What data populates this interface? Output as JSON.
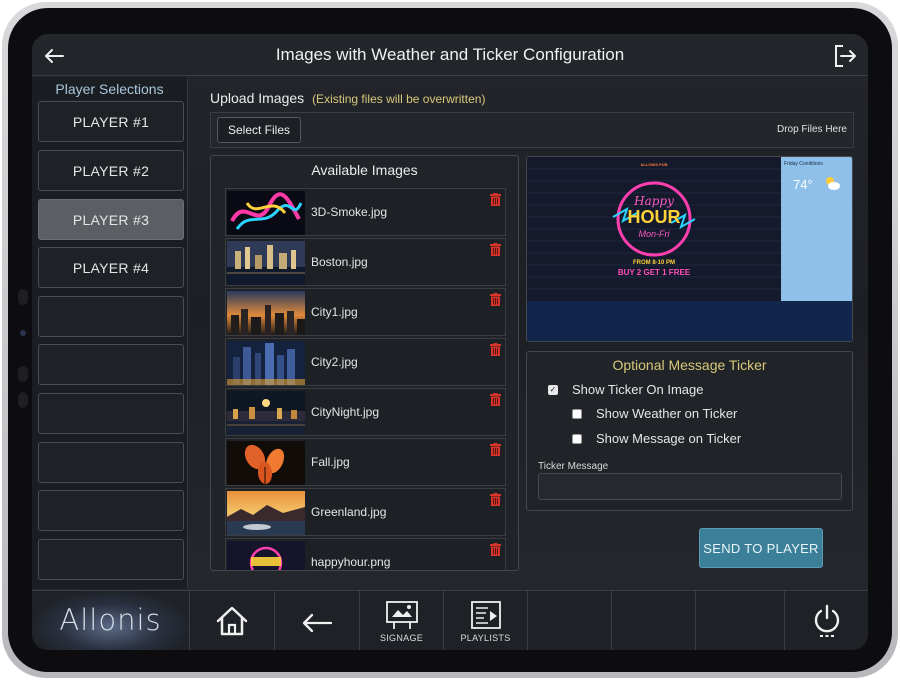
{
  "header": {
    "title": "Images with Weather and Ticker Configuration"
  },
  "sidebar": {
    "title": "Player Selections",
    "players": [
      "PLAYER #1",
      "PLAYER #2",
      "PLAYER #3",
      "PLAYER #4"
    ],
    "selected": "PLAYER #3"
  },
  "upload": {
    "label": "Upload Images",
    "note": "(Existing files will be overwritten)",
    "select_button": "Select Files",
    "drop_text": "Drop Files Here"
  },
  "images": {
    "title": "Available Images",
    "files": [
      "3D-Smoke.jpg",
      "Boston.jpg",
      "City1.jpg",
      "City2.jpg",
      "CityNight.jpg",
      "Fall.jpg",
      "Greenland.jpg",
      "happyhour.png"
    ]
  },
  "preview": {
    "venue": "ALLONIS PUB",
    "sign_line1": "Happy",
    "sign_line2": "HOUR",
    "sign_line3": "Mon-Fri",
    "promo_time": "FROM 8-10 PM",
    "promo_deal": "BUY 2 GET 1 FREE",
    "weather_title": "Friday Conditions",
    "temperature": "74°"
  },
  "ticker": {
    "title": "Optional Message Ticker",
    "show_on_image": {
      "label": "Show Ticker On Image",
      "checked": true
    },
    "show_weather": {
      "label": "Show Weather on Ticker",
      "checked": false
    },
    "show_message": {
      "label": "Show Message on Ticker",
      "checked": false
    },
    "message_label": "Ticker Message",
    "message_value": ""
  },
  "actions": {
    "send": "SEND TO PLAYER"
  },
  "bottom_nav": {
    "logo": "Allonis",
    "items": [
      {
        "icon": "home-icon",
        "label": ""
      },
      {
        "icon": "back-icon",
        "label": ""
      },
      {
        "icon": "signage-icon",
        "label": "SIGNAGE"
      },
      {
        "icon": "playlists-icon",
        "label": "PLAYLISTS"
      },
      {
        "icon": "power-icon",
        "label": ""
      }
    ]
  },
  "colors": {
    "accent": "#3c7f99",
    "note": "#d8c87a",
    "selected_player": "#5b5f64",
    "trash": "#d9342b"
  }
}
